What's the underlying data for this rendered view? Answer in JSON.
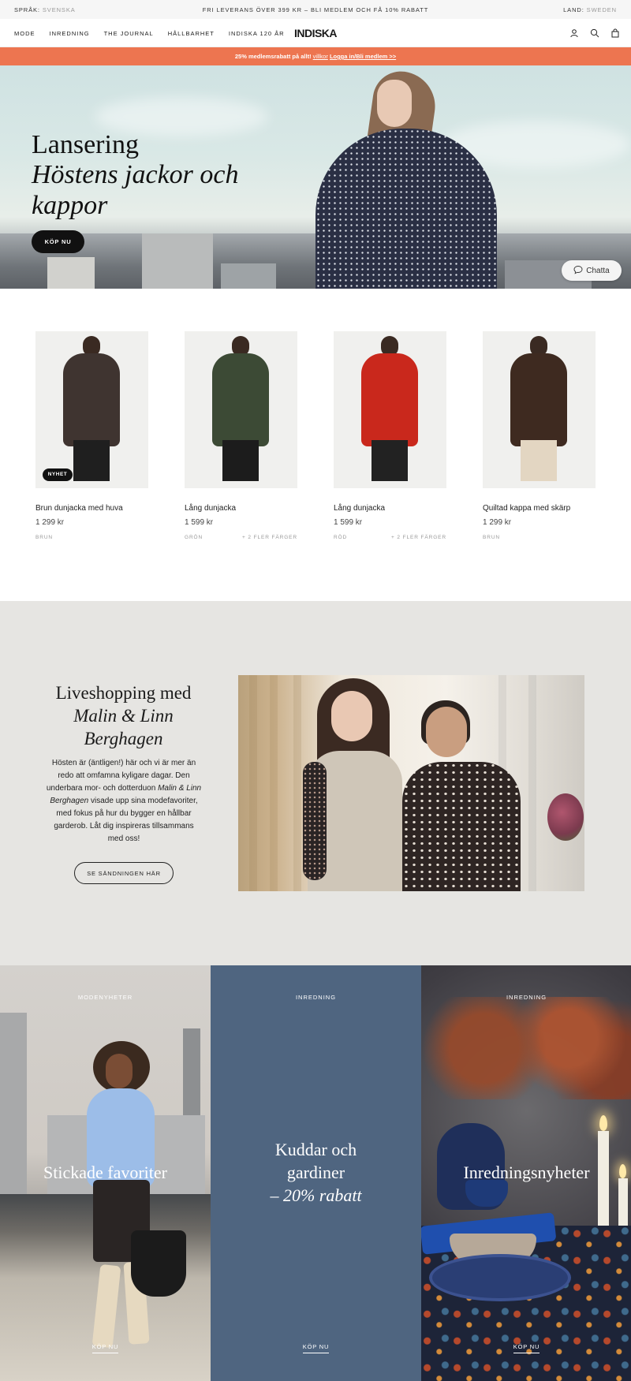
{
  "topbar": {
    "lang_label": "SPRÅK:",
    "lang_value": "SVENSKA",
    "promo": "FRI LEVERANS ÖVER 399 KR – BLI MEDLEM OCH FÅ 10% RABATT",
    "country_label": "LAND:",
    "country_value": "SWEDEN"
  },
  "nav": {
    "links": [
      "MODE",
      "INREDNING",
      "THE JOURNAL",
      "HÅLLBARHET",
      "INDISKA 120 ÅR"
    ],
    "logo": "INDISKA",
    "icons": [
      "account-icon",
      "search-icon",
      "bag-icon"
    ]
  },
  "memberbar": {
    "text": "25% medlemsrabatt på allt!",
    "terms": "villkor",
    "login": "Logga in/Bli medlem >>"
  },
  "hero": {
    "title": "Lansering",
    "subtitle": "Höstens jackor och kappor",
    "cta": "KÖP NU",
    "chat": "Chatta"
  },
  "products": [
    {
      "name": "Brun dunjacka med huva",
      "price": "1 299 kr",
      "color": "BRUN",
      "more": "",
      "badge": "NYHET",
      "coat": "#3f3430",
      "legs": "#1f1f1f"
    },
    {
      "name": "Lång dunjacka",
      "price": "1 599 kr",
      "color": "GRÖN",
      "more": "+ 2 FLER FÄRGER",
      "badge": "",
      "coat": "#3c4a35",
      "legs": "#1c1c1c"
    },
    {
      "name": "Lång dunjacka",
      "price": "1 599 kr",
      "color": "RÖD",
      "more": "+ 2 FLER FÄRGER",
      "badge": "",
      "coat": "#c9281c",
      "legs": "#222222"
    },
    {
      "name": "Quiltad kappa med skärp",
      "price": "1 299 kr",
      "color": "BRUN",
      "more": "",
      "badge": "",
      "coat": "#3e2a20",
      "legs": "#e3d6c2"
    }
  ],
  "live": {
    "title_line1": "Liveshopping med",
    "title_line2": "Malin & Linn",
    "title_line3": "Berghagen",
    "body_part1": "Hösten är (äntligen!) här och vi är mer än redo att omfamna kyligare dagar. Den underbara mor- och dotterduon ",
    "body_italic": "Malin & Linn Berghagen",
    "body_part2": " visade upp sina modefavoriter, med fokus på hur du bygger en hållbar garderob. Låt dig inspireras tillsammans med oss!",
    "button": "SE SÄNDNINGEN HÄR"
  },
  "tiles": [
    {
      "kicker": "MODENYHETER",
      "title": "Stickade favoriter",
      "buy": "KÖP NU"
    },
    {
      "kicker": "INREDNING",
      "title_line1": "Kuddar och",
      "title_line2": "gardiner",
      "title_line3": "– 20% rabatt",
      "buy": "KÖP NU"
    },
    {
      "kicker": "INREDNING",
      "title": "Inredningsnyheter",
      "buy": "KÖP NU"
    }
  ]
}
